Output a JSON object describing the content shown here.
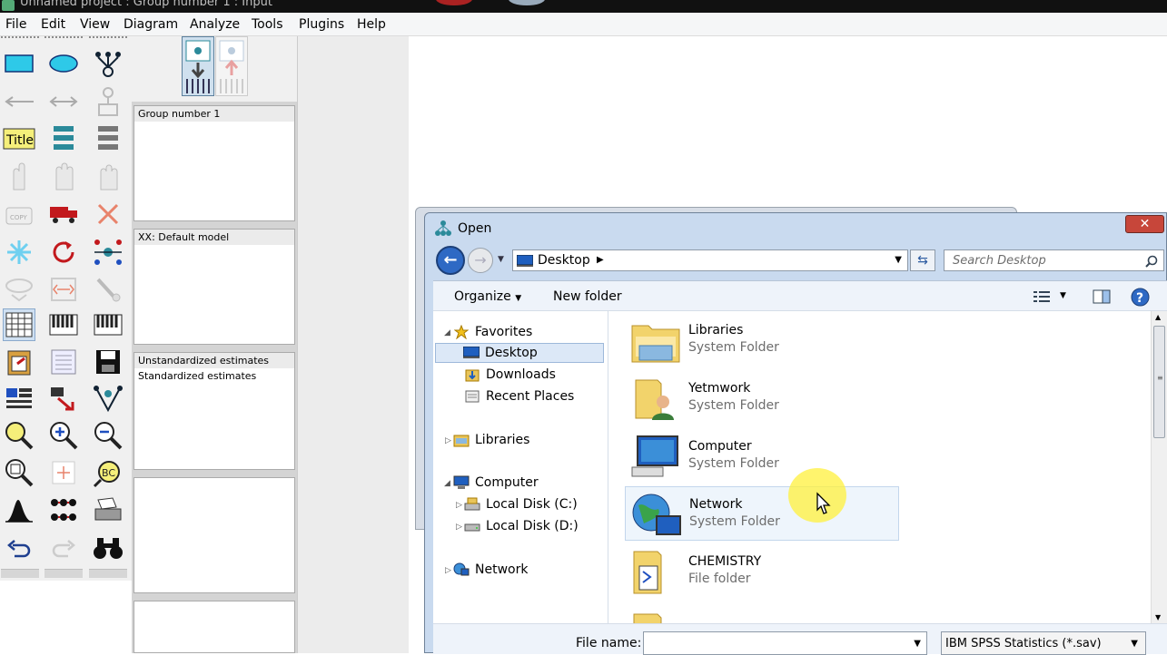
{
  "window": {
    "title": "Unnamed project : Group number 1 : Input"
  },
  "menubar": [
    "File",
    "Edit",
    "View",
    "Diagram",
    "Analyze",
    "Tools",
    "Plugins",
    "Help"
  ],
  "toolbox": {
    "title_tool_label": "Title"
  },
  "panels": {
    "groups": "Group number 1",
    "models": "XX: Default model",
    "estimates": [
      "Unstandardized estimates",
      "Standardized estimates"
    ]
  },
  "dialog": {
    "title": "Open",
    "address": "Desktop",
    "search_placeholder": "Search Desktop",
    "organize_label": "Organize",
    "new_folder_label": "New folder",
    "nav": {
      "favorites": "Favorites",
      "desktop": "Desktop",
      "downloads": "Downloads",
      "recent": "Recent Places",
      "libraries": "Libraries",
      "computer": "Computer",
      "disk_c": "Local Disk (C:)",
      "disk_d": "Local Disk (D:)",
      "network": "Network"
    },
    "files": [
      {
        "name": "Libraries",
        "type": "System Folder"
      },
      {
        "name": "Yetmwork",
        "type": "System Folder"
      },
      {
        "name": "Computer",
        "type": "System Folder"
      },
      {
        "name": "Network",
        "type": "System Folder"
      },
      {
        "name": "CHEMISTRY",
        "type": "File folder"
      }
    ],
    "file_name_label": "File name:",
    "file_name_value": "",
    "file_type": "IBM SPSS Statistics (*.sav)"
  },
  "colors": {
    "accent": "#2e69c4",
    "close": "#c7463a",
    "cursor_highlight": "#fff03c",
    "dialog_frame": "#c9daef"
  }
}
